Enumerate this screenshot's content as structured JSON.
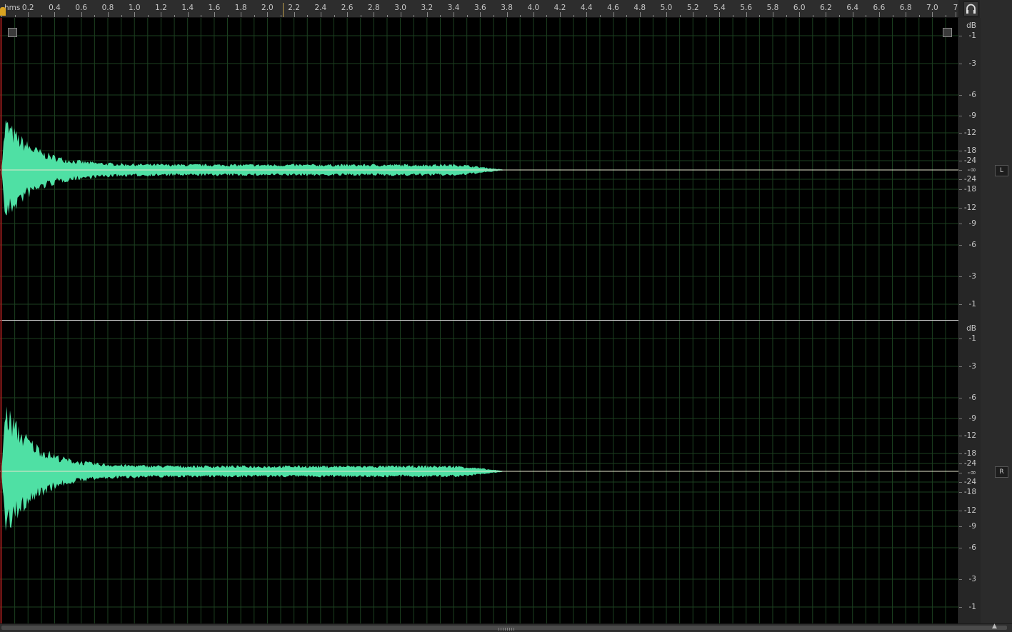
{
  "ruler": {
    "unit": "hms",
    "ticks": [
      "0.2",
      "0.4",
      "0.6",
      "0.8",
      "1.0",
      "1.2",
      "1.4",
      "1.6",
      "1.8",
      "2.0",
      "2.2",
      "2.4",
      "2.6",
      "2.8",
      "3.0",
      "3.2",
      "3.4",
      "3.6",
      "3.8",
      "4.0",
      "4.2",
      "4.4",
      "4.6",
      "4.8",
      "5.0",
      "5.2",
      "5.4",
      "5.6",
      "5.8",
      "6.0",
      "6.2",
      "6.4",
      "6.6",
      "6.8",
      "7.0",
      "7"
    ]
  },
  "db_scale": {
    "unit": "dB",
    "labels": [
      "-1",
      "-3",
      "-6",
      "-9",
      "-12",
      "-18",
      "-24",
      "-∞",
      "-24",
      "-18",
      "-12",
      "-9",
      "-6",
      "-3",
      "-1"
    ]
  },
  "channels": [
    {
      "label": "L",
      "name": "left"
    },
    {
      "label": "R",
      "name": "right"
    }
  ],
  "waveform": {
    "color": "#4fe0a4",
    "attack_seconds": 0.03,
    "end_seconds": 3.8,
    "left": {
      "peak_fraction": 0.42
    },
    "right": {
      "peak_fraction": 0.55
    }
  },
  "colors": {
    "background": "#000000",
    "grid": "#1c4020",
    "center_line": "#e5e5cc",
    "playhead": "#d8a321",
    "start_line": "#9a1c1c"
  }
}
